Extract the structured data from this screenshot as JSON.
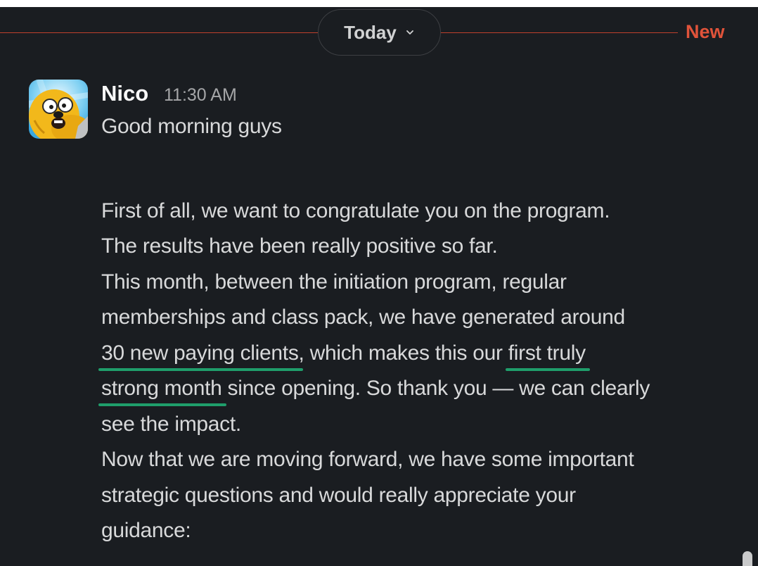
{
  "divider": {
    "day_label": "Today",
    "new_label": "New",
    "chevron_icon": "chevron-down-icon",
    "accent_color": "#e0533a"
  },
  "message": {
    "author": "Nico",
    "time": "11:30 AM",
    "avatar_icon": "avatar-jake-dog-icon",
    "greeting": "Good morning guys",
    "p1_l1": "First of all, we want to congratulate you on the program.",
    "p1_l2": "The results have been really positive so far.",
    "p2_l1": "This month, between the initiation program, regular",
    "p2_l2": "memberships and class pack, we have generated around",
    "hl1": "30 new paying clients",
    "p2_l3_mid": ", which makes this our ",
    "hl2a": "first truly",
    "hl2b": "strong month",
    "p2_l4_rest": " since opening. So thank you — we can clearly",
    "p2_l5": "see the impact.",
    "p3_l1": "Now that we are moving forward, we have some important",
    "p3_l2": "strategic questions and would really appreciate your",
    "p3_l3": "guidance:",
    "highlight_color": "#1f9e6b"
  }
}
